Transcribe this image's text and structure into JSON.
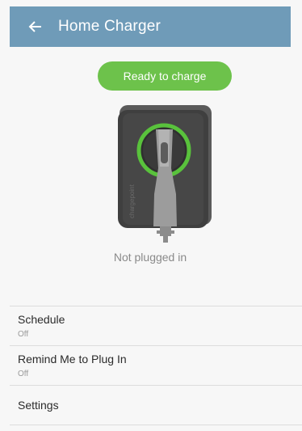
{
  "header": {
    "title": "Home Charger",
    "back_icon": "arrow-left-icon",
    "background": "#6f9bb8"
  },
  "charger": {
    "status_label": "Ready to charge",
    "status_color": "#6dc24b",
    "plug_status": "Not plugged in",
    "device_icon": "charger-device-icon",
    "brand_text": "chargepoint"
  },
  "menu": {
    "items": [
      {
        "label": "Schedule",
        "value": "Off"
      },
      {
        "label": "Remind Me to Plug In",
        "value": "Off"
      },
      {
        "label": "Settings"
      }
    ]
  }
}
